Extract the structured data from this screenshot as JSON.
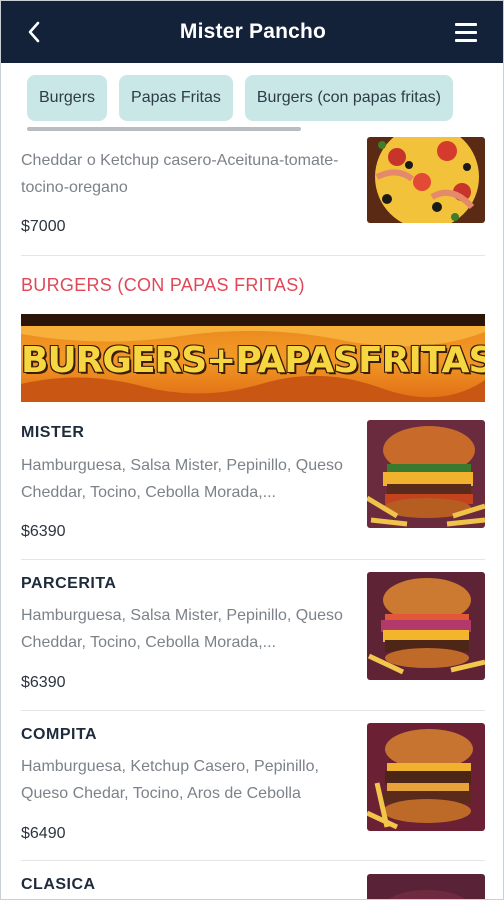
{
  "header": {
    "title": "Mister Pancho",
    "back_icon": "chevron-left-icon",
    "menu_icon": "hamburger-menu-icon",
    "background": "#142239"
  },
  "categories": [
    {
      "label": "Burgers"
    },
    {
      "label": "Papas Fritas"
    },
    {
      "label": "Burgers (con papas fritas)"
    }
  ],
  "partial_item": {
    "description": "Cheddar o Ketchup casero-Aceituna-tomate-tocino-oregano",
    "price": "$7000"
  },
  "section": {
    "title": "BURGERS (CON PAPAS FRITAS)",
    "banner_text": "BURGERS+PAPASFRITAS",
    "accent": "#e04858"
  },
  "items": [
    {
      "name": "MISTER",
      "description": "Hamburguesa, Salsa Mister, Pepinillo, Queso Cheddar, Tocino, Cebolla Morada,...",
      "price": "$6390"
    },
    {
      "name": "PARCERITA",
      "description": "Hamburguesa, Salsa Mister, Pepinillo, Queso Cheddar, Tocino, Cebolla Morada,...",
      "price": "$6390"
    },
    {
      "name": "COMPITA",
      "description": "Hamburguesa, Ketchup Casero, Pepinillo, Queso Chedar, Tocino, Aros de Cebolla",
      "price": "$6490"
    },
    {
      "name": "CLASICA"
    }
  ]
}
